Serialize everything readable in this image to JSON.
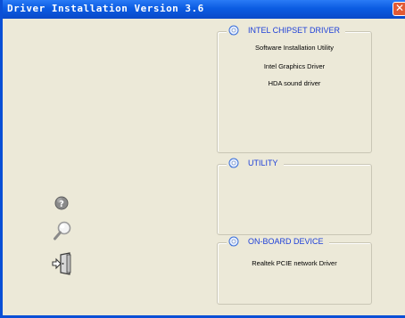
{
  "window": {
    "title": "Driver Installation Version 3.6",
    "close_glyph": "✕"
  },
  "groups": {
    "chipset": {
      "label": "INTEL CHIPSET DRIVER",
      "icon": "disc-icon",
      "items": [
        "Software Installation Utility",
        "Intel Graphics Driver",
        "HDA sound driver"
      ]
    },
    "utility": {
      "label": "UTILITY",
      "icon": "disc-icon",
      "items": []
    },
    "onboard": {
      "label": "ON-BOARD DEVICE",
      "icon": "disc-icon",
      "items": [
        "Realtek PCIE network Driver"
      ]
    }
  },
  "side_icons": [
    "help-icon",
    "search-icon",
    "exit-icon"
  ],
  "colors": {
    "titlebar": "#0b5ce2",
    "legend_text": "#1d3fd8",
    "background": "#ece9d8",
    "close": "#e25a35"
  }
}
